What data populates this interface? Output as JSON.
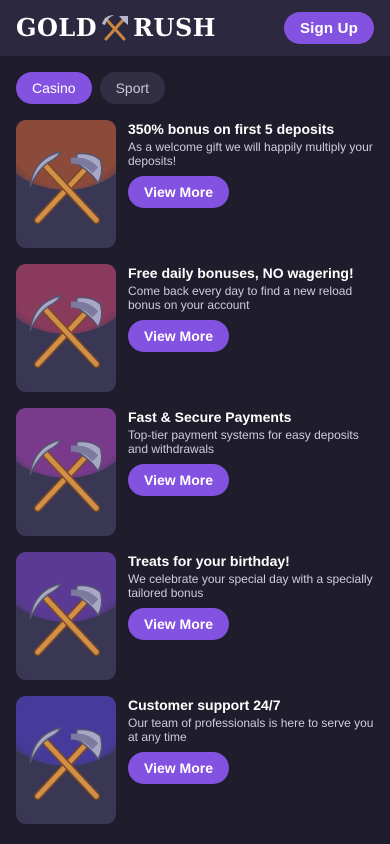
{
  "header": {
    "logo_left": "GOLD",
    "logo_right": "RUSH",
    "signup_label": "Sign Up"
  },
  "tabs": [
    {
      "label": "Casino",
      "active": true
    },
    {
      "label": "Sport",
      "active": false
    }
  ],
  "colors": {
    "accent": "#8452e0",
    "background": "#1f1c2c",
    "header": "#2b2840"
  },
  "promos": [
    {
      "title": "350% bonus on first 5 deposits",
      "desc": "As a welcome gift we will happily multiply your deposits!",
      "button": "View More",
      "icon": "pickaxes-icon",
      "glow": "#8c4a3a"
    },
    {
      "title": "Free daily bonuses, NO wagering!",
      "desc": "Come back every day to find a new reload bonus on your account",
      "button": "View More",
      "icon": "pickaxes-icon",
      "glow": "#8a3a5c"
    },
    {
      "title": "Fast & Secure Payments",
      "desc": "Top-tier payment systems for easy deposits and withdrawals",
      "button": "View More",
      "icon": "pickaxes-icon",
      "glow": "#7a3a8c"
    },
    {
      "title": "Treats for your birthday!",
      "desc": "We celebrate your special day with a specially tailored bonus",
      "button": "View More",
      "icon": "pickaxes-icon",
      "glow": "#5a3a94"
    },
    {
      "title": "Customer support 24/7",
      "desc": "Our team of professionals is here to serve you at any time",
      "button": "View More",
      "icon": "pickaxes-icon",
      "glow": "#463a9a"
    }
  ]
}
